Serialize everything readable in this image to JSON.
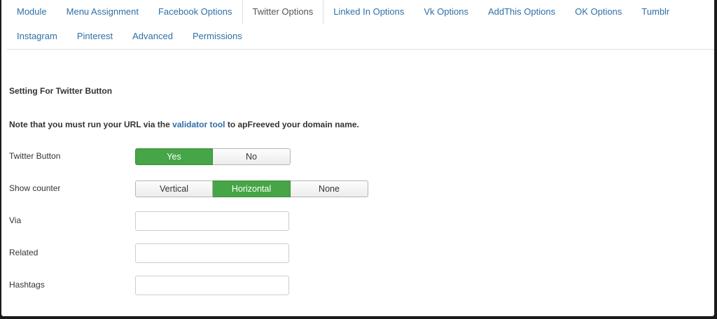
{
  "tabs": {
    "row1": [
      "Module",
      "Menu Assignment",
      "Facebook Options",
      "Twitter Options",
      "Linked In Options",
      "Vk Options",
      "AddThis Options",
      "OK Options",
      "Tumblr"
    ],
    "row2": [
      "Instagram",
      "Pinterest",
      "Advanced",
      "Permissions"
    ],
    "active": "Twitter Options"
  },
  "section": {
    "heading": "Setting For Twitter Button",
    "note_prefix": "Note that you must run your URL via the",
    "note_link": "validator tool",
    "note_suffix": "to apFreeved your domain name."
  },
  "twitter_button": {
    "label": "Twitter Button",
    "options": [
      "Yes",
      "No"
    ],
    "selected": "Yes"
  },
  "show_counter": {
    "label": "Show counter",
    "options": [
      "Vertical",
      "Horizontal",
      "None"
    ],
    "selected": "Horizontal"
  },
  "fields": {
    "via": {
      "label": "Via",
      "value": ""
    },
    "related": {
      "label": "Related",
      "value": ""
    },
    "hashtags": {
      "label": "Hashtags",
      "value": ""
    }
  },
  "colors": {
    "link": "#2f6fa7",
    "selected": "#46a546"
  }
}
